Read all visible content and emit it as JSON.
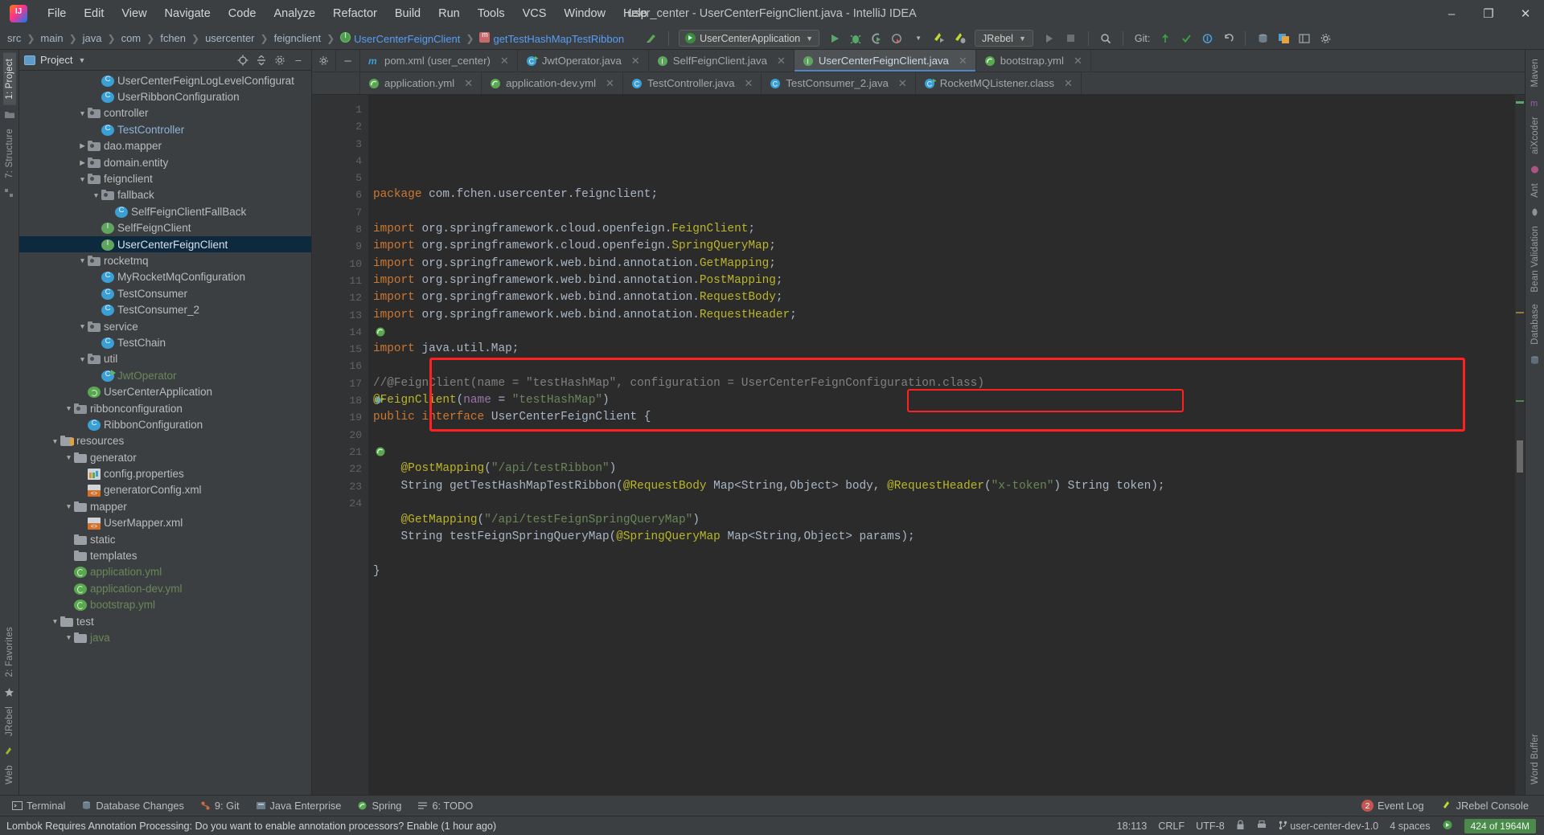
{
  "window": {
    "title": "user_center - UserCenterFeignClient.java - IntelliJ IDEA",
    "minimize": "–",
    "maximize": "❐",
    "close": "✕"
  },
  "menu": {
    "items": [
      "File",
      "Edit",
      "View",
      "Navigate",
      "Code",
      "Analyze",
      "Refactor",
      "Build",
      "Run",
      "Tools",
      "VCS",
      "Window",
      "Help"
    ]
  },
  "navbar": {
    "breadcrumbs": [
      "src",
      "main",
      "java",
      "com",
      "fchen",
      "usercenter",
      "feignclient",
      "UserCenterFeignClient",
      "getTestHashMapTestRibbon"
    ],
    "run_config": "UserCenterApplication",
    "jrebel_label": "JRebel",
    "git_label": "Git:"
  },
  "project_panel": {
    "title": "Project",
    "tree": [
      {
        "indent": 5,
        "arrow": "none",
        "icon": "class",
        "label": "UserCenterFeignLogLevelConfigurat",
        "color": "grey"
      },
      {
        "indent": 5,
        "arrow": "none",
        "icon": "class",
        "label": "UserRibbonConfiguration",
        "color": "grey"
      },
      {
        "indent": 4,
        "arrow": "down",
        "icon": "pkg",
        "label": "controller",
        "color": "grey"
      },
      {
        "indent": 5,
        "arrow": "none",
        "icon": "class",
        "label": "TestController",
        "color": "blue"
      },
      {
        "indent": 4,
        "arrow": "right",
        "icon": "pkg",
        "label": "dao.mapper",
        "color": "grey"
      },
      {
        "indent": 4,
        "arrow": "right",
        "icon": "pkg",
        "label": "domain.entity",
        "color": "grey"
      },
      {
        "indent": 4,
        "arrow": "down",
        "icon": "pkg",
        "label": "feignclient",
        "color": "grey"
      },
      {
        "indent": 5,
        "arrow": "down",
        "icon": "pkg",
        "label": "fallback",
        "color": "grey"
      },
      {
        "indent": 6,
        "arrow": "none",
        "icon": "class",
        "label": "SelfFeignClientFallBack",
        "color": "grey"
      },
      {
        "indent": 5,
        "arrow": "none",
        "icon": "iface",
        "label": "SelfFeignClient",
        "color": "grey"
      },
      {
        "indent": 5,
        "arrow": "none",
        "icon": "iface",
        "label": "UserCenterFeignClient",
        "color": "grey",
        "selected": true
      },
      {
        "indent": 4,
        "arrow": "down",
        "icon": "pkg",
        "label": "rocketmq",
        "color": "grey"
      },
      {
        "indent": 5,
        "arrow": "none",
        "icon": "class",
        "label": "MyRocketMqConfiguration",
        "color": "grey"
      },
      {
        "indent": 5,
        "arrow": "none",
        "icon": "class",
        "label": "TestConsumer",
        "color": "grey"
      },
      {
        "indent": 5,
        "arrow": "none",
        "icon": "class",
        "label": "TestConsumer_2",
        "color": "grey"
      },
      {
        "indent": 4,
        "arrow": "down",
        "icon": "pkg",
        "label": "service",
        "color": "grey"
      },
      {
        "indent": 5,
        "arrow": "none",
        "icon": "class",
        "label": "TestChain",
        "color": "grey"
      },
      {
        "indent": 4,
        "arrow": "down",
        "icon": "pkg",
        "label": "util",
        "color": "grey"
      },
      {
        "indent": 5,
        "arrow": "none",
        "icon": "classrun",
        "label": "JwtOperator",
        "color": "green"
      },
      {
        "indent": 4,
        "arrow": "none",
        "icon": "spring",
        "label": "UserCenterApplication",
        "color": "grey"
      },
      {
        "indent": 3,
        "arrow": "down",
        "icon": "pkg",
        "label": "ribbonconfiguration",
        "color": "grey"
      },
      {
        "indent": 4,
        "arrow": "none",
        "icon": "class",
        "label": "RibbonConfiguration",
        "color": "grey"
      },
      {
        "indent": 2,
        "arrow": "down",
        "icon": "res",
        "label": "resources",
        "color": "grey"
      },
      {
        "indent": 3,
        "arrow": "down",
        "icon": "folder",
        "label": "generator",
        "color": "grey"
      },
      {
        "indent": 4,
        "arrow": "none",
        "icon": "props",
        "label": "config.properties",
        "color": "grey"
      },
      {
        "indent": 4,
        "arrow": "none",
        "icon": "xml",
        "label": "generatorConfig.xml",
        "color": "grey"
      },
      {
        "indent": 3,
        "arrow": "down",
        "icon": "folder",
        "label": "mapper",
        "color": "grey"
      },
      {
        "indent": 4,
        "arrow": "none",
        "icon": "xml",
        "label": "UserMapper.xml",
        "color": "grey"
      },
      {
        "indent": 3,
        "arrow": "none",
        "icon": "folder",
        "label": "static",
        "color": "grey"
      },
      {
        "indent": 3,
        "arrow": "none",
        "icon": "folder",
        "label": "templates",
        "color": "grey"
      },
      {
        "indent": 3,
        "arrow": "none",
        "icon": "yml",
        "label": "application.yml",
        "color": "green"
      },
      {
        "indent": 3,
        "arrow": "none",
        "icon": "yml",
        "label": "application-dev.yml",
        "color": "green"
      },
      {
        "indent": 3,
        "arrow": "none",
        "icon": "yml",
        "label": "bootstrap.yml",
        "color": "green"
      },
      {
        "indent": 2,
        "arrow": "down",
        "icon": "folder",
        "label": "test",
        "color": "grey"
      },
      {
        "indent": 3,
        "arrow": "down",
        "icon": "folder",
        "label": "java",
        "color": "green"
      }
    ]
  },
  "left_strip": {
    "tabs": [
      "1: Project",
      "7: Structure"
    ],
    "bottom_tabs": [
      "2: Favorites",
      "JRebel",
      "Web"
    ]
  },
  "right_strip": {
    "tabs": [
      "Maven",
      "aiXcoder",
      "Ant",
      "Bean Validation",
      "Database"
    ],
    "bottom_tabs": [
      "Word Buffer"
    ]
  },
  "editor": {
    "tabs_row1": [
      {
        "label": "pom.xml (user_center)",
        "icon": "maven",
        "active": false,
        "closable": true
      },
      {
        "label": "JwtOperator.java",
        "icon": "classrun",
        "active": false,
        "closable": true
      },
      {
        "label": "SelfFeignClient.java",
        "icon": "iface",
        "active": false,
        "closable": true
      },
      {
        "label": "UserCenterFeignClient.java",
        "icon": "iface",
        "active": true,
        "closable": true
      },
      {
        "label": "bootstrap.yml",
        "icon": "yml",
        "active": false,
        "closable": true
      }
    ],
    "tabs_row2": [
      {
        "label": "application.yml",
        "icon": "yml",
        "active": false,
        "closable": true
      },
      {
        "label": "application-dev.yml",
        "icon": "yml",
        "active": false,
        "closable": true
      },
      {
        "label": "TestController.java",
        "icon": "class",
        "active": false,
        "closable": true
      },
      {
        "label": "TestConsumer_2.java",
        "icon": "class",
        "active": false,
        "closable": true
      },
      {
        "label": "RocketMQListener.class",
        "icon": "classrun",
        "active": false,
        "closable": true
      }
    ],
    "lines": [
      {
        "n": 1,
        "tokens": [
          {
            "t": "package ",
            "c": "kw"
          },
          {
            "t": "com.fchen.usercenter.feignclient;",
            "c": "cls"
          }
        ]
      },
      {
        "n": 2,
        "tokens": []
      },
      {
        "n": 3,
        "fold": true,
        "tokens": [
          {
            "t": "import ",
            "c": "kw"
          },
          {
            "t": "org.springframework.cloud.openfeign.",
            "c": "cls"
          },
          {
            "t": "FeignClient",
            "c": "ann"
          },
          {
            "t": ";",
            "c": "cls"
          }
        ]
      },
      {
        "n": 4,
        "tokens": [
          {
            "t": "import ",
            "c": "kw"
          },
          {
            "t": "org.springframework.cloud.openfeign.",
            "c": "cls"
          },
          {
            "t": "SpringQueryMap",
            "c": "ann"
          },
          {
            "t": ";",
            "c": "cls"
          }
        ]
      },
      {
        "n": 5,
        "tokens": [
          {
            "t": "import ",
            "c": "kw"
          },
          {
            "t": "org.springframework.web.bind.annotation.",
            "c": "cls"
          },
          {
            "t": "GetMapping",
            "c": "ann"
          },
          {
            "t": ";",
            "c": "cls"
          }
        ]
      },
      {
        "n": 6,
        "tokens": [
          {
            "t": "import ",
            "c": "kw"
          },
          {
            "t": "org.springframework.web.bind.annotation.",
            "c": "cls"
          },
          {
            "t": "PostMapping",
            "c": "ann"
          },
          {
            "t": ";",
            "c": "cls"
          }
        ]
      },
      {
        "n": 7,
        "tokens": [
          {
            "t": "import ",
            "c": "kw"
          },
          {
            "t": "org.springframework.web.bind.annotation.",
            "c": "cls"
          },
          {
            "t": "RequestBody",
            "c": "ann"
          },
          {
            "t": ";",
            "c": "cls"
          }
        ]
      },
      {
        "n": 8,
        "tokens": [
          {
            "t": "import ",
            "c": "kw"
          },
          {
            "t": "org.springframework.web.bind.annotation.",
            "c": "cls"
          },
          {
            "t": "RequestHeader",
            "c": "ann"
          },
          {
            "t": ";",
            "c": "cls"
          }
        ]
      },
      {
        "n": 9,
        "tokens": []
      },
      {
        "n": 10,
        "fold": true,
        "tokens": [
          {
            "t": "import ",
            "c": "kw"
          },
          {
            "t": "java.util.Map;",
            "c": "cls"
          }
        ]
      },
      {
        "n": 11,
        "tokens": []
      },
      {
        "n": 12,
        "tokens": [
          {
            "t": "//@FeignClient(name = \"testHashMap\", configuration = UserCenterFeignConfiguration.class)",
            "c": "cmt"
          }
        ]
      },
      {
        "n": 13,
        "tokens": [
          {
            "t": "@FeignClient",
            "c": "ann"
          },
          {
            "t": "(",
            "c": "cls"
          },
          {
            "t": "name",
            "c": "prm"
          },
          {
            "t": " = ",
            "c": "cls"
          },
          {
            "t": "\"testHashMap\"",
            "c": "str"
          },
          {
            "t": ")",
            "c": "cls"
          }
        ]
      },
      {
        "n": 14,
        "gmark": "spring",
        "tokens": [
          {
            "t": "public ",
            "c": "kw"
          },
          {
            "t": "interface ",
            "c": "kw"
          },
          {
            "t": "UserCenterFeignClient {",
            "c": "cls"
          }
        ]
      },
      {
        "n": 15,
        "tokens": []
      },
      {
        "n": 16,
        "tokens": []
      },
      {
        "n": 17,
        "tokens": [
          {
            "t": "    ",
            "c": "cls"
          },
          {
            "t": "@PostMapping",
            "c": "ann"
          },
          {
            "t": "(",
            "c": "cls"
          },
          {
            "t": "\"/api/testRibbon\"",
            "c": "str"
          },
          {
            "t": ")",
            "c": "cls"
          }
        ]
      },
      {
        "n": 18,
        "gmark": "impl",
        "tokens": [
          {
            "t": "    ",
            "c": "cls"
          },
          {
            "t": "String ",
            "c": "cls"
          },
          {
            "t": "getTestHashMapTestRibbon",
            "c": "cls"
          },
          {
            "t": "(",
            "c": "cls"
          },
          {
            "t": "@RequestBody",
            "c": "ann"
          },
          {
            "t": " Map<String,Object> body, ",
            "c": "cls"
          },
          {
            "t": "@RequestHeader",
            "c": "ann"
          },
          {
            "t": "(",
            "c": "cls"
          },
          {
            "t": "\"x-token\"",
            "c": "str"
          },
          {
            "t": ") String token",
            "c": "cls"
          },
          {
            "t": ")",
            "c": "cls"
          },
          {
            "t": ";",
            "c": "cls"
          }
        ]
      },
      {
        "n": 19,
        "tokens": []
      },
      {
        "n": 20,
        "tokens": [
          {
            "t": "    ",
            "c": "cls"
          },
          {
            "t": "@GetMapping",
            "c": "ann"
          },
          {
            "t": "(",
            "c": "cls"
          },
          {
            "t": "\"/api/testFeignSpringQueryMap\"",
            "c": "str"
          },
          {
            "t": ")",
            "c": "cls"
          }
        ]
      },
      {
        "n": 21,
        "gmark": "spring",
        "tokens": [
          {
            "t": "    String testFeignSpringQueryMap(",
            "c": "cls"
          },
          {
            "t": "@SpringQueryMap",
            "c": "ann"
          },
          {
            "t": " Map<String,Object> params);",
            "c": "cls"
          }
        ]
      },
      {
        "n": 22,
        "tokens": []
      },
      {
        "n": 23,
        "tokens": [
          {
            "t": "}",
            "c": "cls"
          }
        ]
      },
      {
        "n": 24,
        "tokens": []
      }
    ]
  },
  "bottom_tool_bar": {
    "items": [
      "Terminal",
      "Database Changes",
      "9: Git",
      "Java Enterprise",
      "Spring",
      "6: TODO"
    ],
    "right_items": [
      "Event Log",
      "JRebel Console"
    ],
    "event_log_count": "2"
  },
  "status_bar": {
    "message": "Lombok Requires Annotation Processing: Do you want to enable annotation processors? Enable (1 hour ago)",
    "position": "18:113",
    "line_ending": "CRLF",
    "encoding": "UTF-8",
    "branch": "user-center-dev-1.0",
    "indent": "4 spaces",
    "memory": "424 of 1964M"
  },
  "colors": {
    "accent_blue": "#4a88c7",
    "selection_blue": "#0d293e",
    "annotation_red": "#ff2020",
    "keyword_orange": "#cc7832",
    "string_green": "#6a8759",
    "annotation_yellow": "#bbb529",
    "memory_green": "#4c8a4c"
  }
}
